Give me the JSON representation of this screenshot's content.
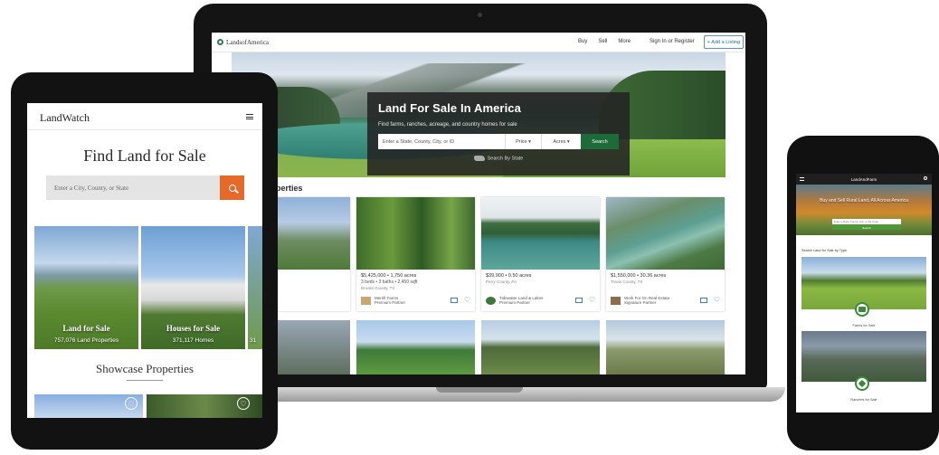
{
  "laptop": {
    "site_name": "LandsofAmerica",
    "nav": {
      "buy": "Buy",
      "sell": "Sell",
      "more": "More",
      "signin": "Sign In or Register",
      "add_listing": "+ Add a Listing"
    },
    "hero": {
      "title": "Land For Sale In America",
      "subtitle": "Find farms, ranches, acreage, and country homes for sale",
      "search_placeholder": "Enter a State, County, City, or ID",
      "price_label": "Price",
      "acres_label": "Acres",
      "search_button": "Search",
      "search_by_state": "Search By State"
    },
    "section_title": "Properties",
    "cards": [
      {
        "price": "",
        "detail": "",
        "location": "",
        "broker": ""
      },
      {
        "price": "$5,425,000 • 1,750 acres",
        "detail": "3 beds • 3 baths • 2,450 sqft",
        "location": "Brooks County, TX",
        "broker": "Merrill Farms",
        "broker_sub": "Premium Partner"
      },
      {
        "price": "$39,900 • 0.50 acres",
        "detail": "",
        "location": "Perry County, PA",
        "broker": "Tidewater Land & Lakes",
        "broker_sub": "Premium Partner"
      },
      {
        "price": "$1,550,000 • 30.36 acres",
        "detail": "",
        "location": "Travis County, TX",
        "broker": "Work For Gn Real Estate",
        "broker_sub": "Signature Partner"
      }
    ]
  },
  "tablet": {
    "logo": "LandWatch",
    "title": "Find Land for Sale",
    "search_placeholder": "Enter a City, County, or State",
    "tiles": [
      {
        "label": "Land for Sale",
        "count": "757,076 Land Properties"
      },
      {
        "label": "Houses for Sale",
        "count": "371,117 Homes"
      },
      {
        "label": "",
        "count": "31"
      }
    ],
    "showcase_title": "Showcase Properties"
  },
  "phone": {
    "site_name": "LandAndFarm",
    "hero_text": "Buy and Sell Rural Land, All Across America",
    "search_placeholder": "Enter a State, County, City, or Zip Code",
    "search_button": "Search",
    "section_title": "Search Land for Sale by Type",
    "tiles": [
      {
        "label": "Farms for Sale"
      },
      {
        "label": "Ranches for Sale"
      }
    ]
  },
  "colors": {
    "lands_green": "#1e6b3a",
    "landwatch_orange": "#e56a2a",
    "link_blue": "#2a6fb0"
  }
}
